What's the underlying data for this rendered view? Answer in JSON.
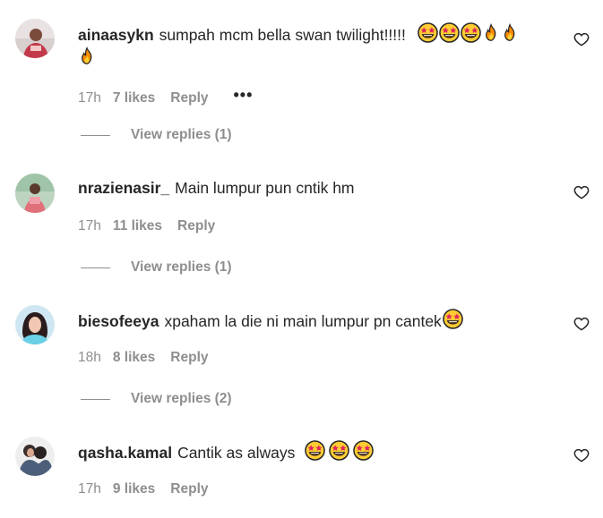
{
  "colors": {
    "text": "#262626",
    "secondary": "#8e8e8e",
    "background": "#ffffff"
  },
  "icons": {
    "heart": "heart-outline-icon",
    "star_eyes": "star-struck-emoji",
    "fire": "fire-emoji",
    "more": "more-options-icon"
  },
  "comments": [
    {
      "username": "ainaasykn",
      "text": "sumpah mcm bella swan twilight!!!!!",
      "time": "17h",
      "likes": "7 likes",
      "reply": "Reply",
      "more": "•••",
      "view_replies": "View replies (1)"
    },
    {
      "username": "nrazienasir_",
      "text": "Main lumpur pun cntik hm",
      "time": "17h",
      "likes": "11 likes",
      "reply": "Reply",
      "view_replies": "View replies (1)"
    },
    {
      "username": "biesofeeya",
      "text": "xpaham la die ni main lumpur pn cantek",
      "time": "18h",
      "likes": "8 likes",
      "reply": "Reply",
      "view_replies": "View replies (2)"
    },
    {
      "username": "qasha.kamal",
      "text": "Cantik as always",
      "time": "17h",
      "likes": "9 likes",
      "reply": "Reply"
    }
  ]
}
